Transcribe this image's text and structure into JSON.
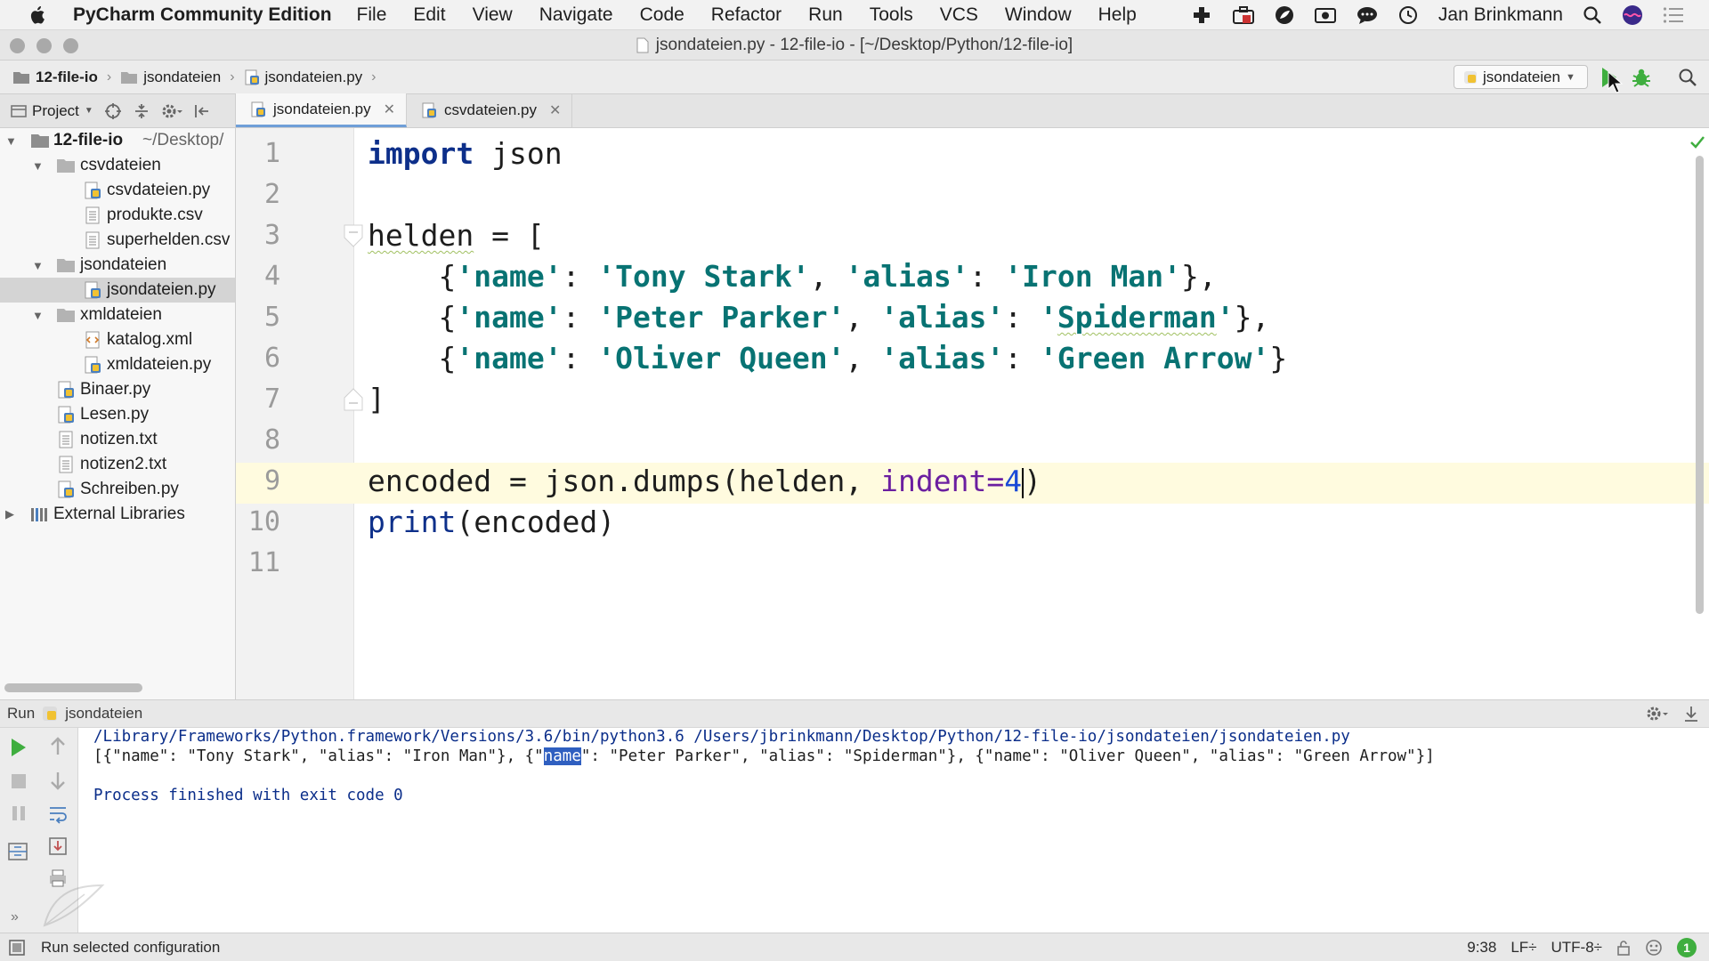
{
  "menubar": {
    "app_name": "PyCharm Community Edition",
    "menus": [
      "File",
      "Edit",
      "View",
      "Navigate",
      "Code",
      "Refactor",
      "Run",
      "Tools",
      "VCS",
      "Window",
      "Help"
    ],
    "user": "Jan Brinkmann"
  },
  "window": {
    "title": "jsondateien.py - 12-file-io - [~/Desktop/Python/12-file-io]"
  },
  "navbar": {
    "breadcrumbs": [
      "12-file-io",
      "jsondateien",
      "jsondateien.py"
    ],
    "run_config": "jsondateien"
  },
  "project_panel": {
    "label": "Project",
    "tree": [
      {
        "label": "12-file-io",
        "suffix": "~/Desktop/",
        "type": "folder",
        "depth": 0,
        "expanded": true
      },
      {
        "label": "csvdateien",
        "type": "folder",
        "depth": 1,
        "expanded": true
      },
      {
        "label": "csvdateien.py",
        "type": "py",
        "depth": 2
      },
      {
        "label": "produkte.csv",
        "type": "text",
        "depth": 2
      },
      {
        "label": "superhelden.csv",
        "type": "text",
        "depth": 2
      },
      {
        "label": "jsondateien",
        "type": "folder",
        "depth": 1,
        "expanded": true
      },
      {
        "label": "jsondateien.py",
        "type": "py",
        "depth": 2,
        "selected": true
      },
      {
        "label": "xmldateien",
        "type": "folder",
        "depth": 1,
        "expanded": true
      },
      {
        "label": "katalog.xml",
        "type": "xml",
        "depth": 2
      },
      {
        "label": "xmldateien.py",
        "type": "py",
        "depth": 2
      },
      {
        "label": "Binaer.py",
        "type": "py",
        "depth": 1
      },
      {
        "label": "Lesen.py",
        "type": "py",
        "depth": 1
      },
      {
        "label": "notizen.txt",
        "type": "text",
        "depth": 1
      },
      {
        "label": "notizen2.txt",
        "type": "text",
        "depth": 1
      },
      {
        "label": "Schreiben.py",
        "type": "py",
        "depth": 1
      },
      {
        "label": "External Libraries",
        "type": "lib",
        "depth": 0,
        "expanded": false
      }
    ]
  },
  "tabs": [
    {
      "label": "jsondateien.py",
      "active": true
    },
    {
      "label": "csvdateien.py",
      "active": false
    }
  ],
  "editor": {
    "line_numbers": [
      "1",
      "2",
      "3",
      "4",
      "5",
      "6",
      "7",
      "8",
      "9",
      "10",
      "11"
    ],
    "current_line": "9",
    "code": {
      "l1_kw": "import",
      "l1_rest": " json",
      "l3_var": "helden",
      "l3_rest": " = [",
      "l4_open": "    {",
      "l4_k1": "'name'",
      "l4_c1": ": ",
      "l4_v1": "'Tony Stark'",
      "l4_c2": ", ",
      "l4_k2": "'alias'",
      "l4_c3": ": ",
      "l4_v2": "'Iron Man'",
      "l4_end": "},",
      "l5_open": "    {",
      "l5_k1": "'name'",
      "l5_c1": ": ",
      "l5_v1": "'Peter Parker'",
      "l5_c2": ", ",
      "l5_k2": "'alias'",
      "l5_c3": ": ",
      "l5_q1": "'",
      "l5_v2": "Spiderman",
      "l5_q2": "'",
      "l5_end": "},",
      "l6_open": "    {",
      "l6_k1": "'name'",
      "l6_c1": ": ",
      "l6_v1": "'Oliver Queen'",
      "l6_c2": ", ",
      "l6_k2": "'alias'",
      "l6_c3": ": ",
      "l6_v2": "'Green Arrow'",
      "l6_end": "}",
      "l7": "]",
      "l9_a": "encoded = json.dumps(helden, ",
      "l9_kw": "indent=",
      "l9_num": "4",
      "l9_end": ")",
      "l10_fn": "print",
      "l10_rest": "(encoded)"
    }
  },
  "run_panel": {
    "label": "Run",
    "config": "jsondateien",
    "console": {
      "command": "/Library/Frameworks/Python.framework/Versions/3.6/bin/python3.6 /Users/jbrinkmann/Desktop/Python/12-file-io/jsondateien/jsondateien.py",
      "out_a": "[{\"name\": \"Tony Stark\", \"alias\": \"Iron Man\"}, {\"",
      "out_hl": "name",
      "out_b": "\": \"Peter Parker\", \"alias\": \"Spiderman\"}, {\"name\": \"Oliver Queen\", \"alias\": \"Green Arrow\"}]",
      "finished": "Process finished with exit code 0"
    }
  },
  "statusbar": {
    "message": "Run selected configuration",
    "position": "9:38",
    "line_sep": "LF÷",
    "encoding": "UTF-8÷",
    "events": "1"
  },
  "colors": {
    "keyword": "#0d2f8a",
    "string": "#087373",
    "kwarg": "#6b1fa0",
    "number": "#1a4ad6",
    "run_green": "#3fae3f",
    "caret_line": "#fffbdf"
  }
}
